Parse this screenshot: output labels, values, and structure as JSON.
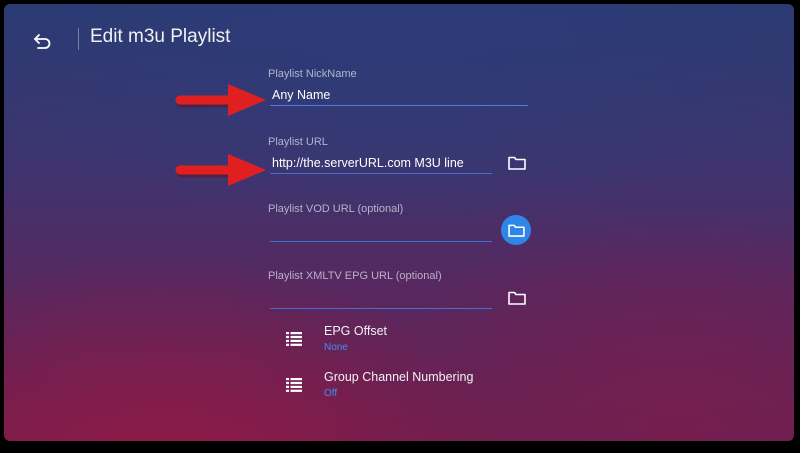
{
  "header": {
    "title": "Edit m3u Playlist",
    "back_icon": "back-arrow-icon"
  },
  "fields": {
    "nickname": {
      "label": "Playlist NickName",
      "value": "Any Name"
    },
    "url": {
      "label": "Playlist URL",
      "value": "http://the.serverURL.com M3U line"
    },
    "vod_url": {
      "label": "Playlist VOD URL (optional)",
      "value": ""
    },
    "epg_url": {
      "label": "Playlist XMLTV EPG URL (optional)",
      "value": ""
    }
  },
  "settings": {
    "epg_offset": {
      "title": "EPG Offset",
      "value": "None"
    },
    "group_numbering": {
      "title": "Group Channel Numbering",
      "value": "Off"
    }
  },
  "colors": {
    "accent": "#2f86e8",
    "value_text": "#3d8ef0",
    "annotation_arrow": "#e02020"
  }
}
